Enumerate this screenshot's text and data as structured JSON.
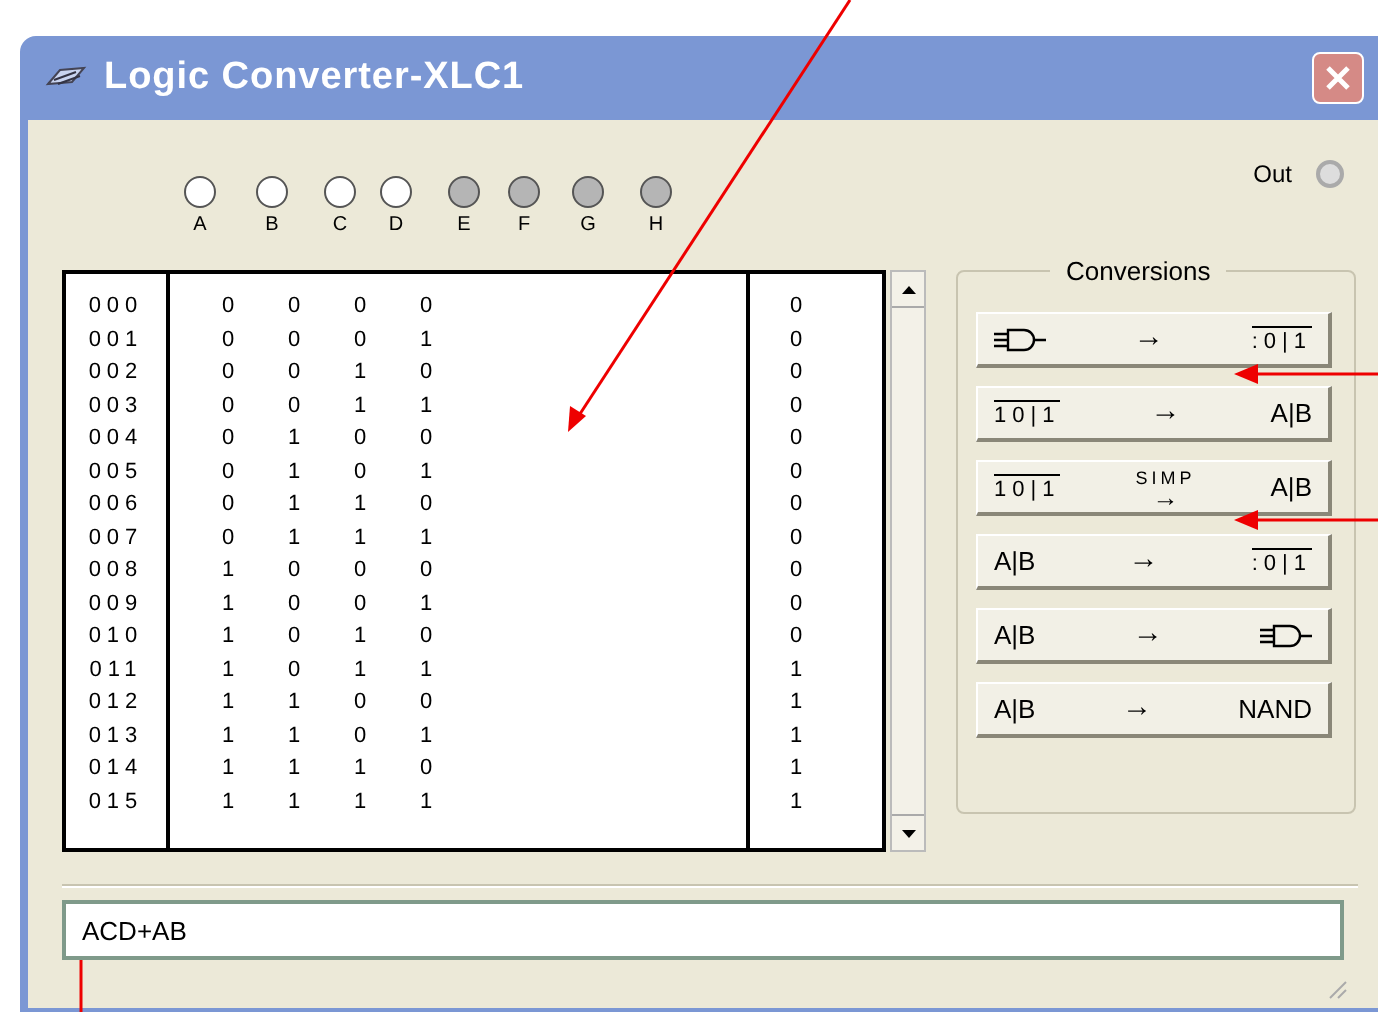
{
  "window": {
    "title": "Logic Converter-XLC1"
  },
  "output_terminal": {
    "label": "Out"
  },
  "input_terminals": [
    {
      "label": "A",
      "active": true
    },
    {
      "label": "B",
      "active": true
    },
    {
      "label": "C",
      "active": true
    },
    {
      "label": "D",
      "active": true
    },
    {
      "label": "E",
      "active": false
    },
    {
      "label": "F",
      "active": false
    },
    {
      "label": "G",
      "active": false
    },
    {
      "label": "H",
      "active": false
    }
  ],
  "truth_table": {
    "rows": [
      {
        "index": "000",
        "inputs": [
          "0",
          "0",
          "0",
          "0"
        ],
        "output": "0"
      },
      {
        "index": "001",
        "inputs": [
          "0",
          "0",
          "0",
          "1"
        ],
        "output": "0"
      },
      {
        "index": "002",
        "inputs": [
          "0",
          "0",
          "1",
          "0"
        ],
        "output": "0"
      },
      {
        "index": "003",
        "inputs": [
          "0",
          "0",
          "1",
          "1"
        ],
        "output": "0"
      },
      {
        "index": "004",
        "inputs": [
          "0",
          "1",
          "0",
          "0"
        ],
        "output": "0"
      },
      {
        "index": "005",
        "inputs": [
          "0",
          "1",
          "0",
          "1"
        ],
        "output": "0"
      },
      {
        "index": "006",
        "inputs": [
          "0",
          "1",
          "1",
          "0"
        ],
        "output": "0"
      },
      {
        "index": "007",
        "inputs": [
          "0",
          "1",
          "1",
          "1"
        ],
        "output": "0"
      },
      {
        "index": "008",
        "inputs": [
          "1",
          "0",
          "0",
          "0"
        ],
        "output": "0"
      },
      {
        "index": "009",
        "inputs": [
          "1",
          "0",
          "0",
          "1"
        ],
        "output": "0"
      },
      {
        "index": "010",
        "inputs": [
          "1",
          "0",
          "1",
          "0"
        ],
        "output": "0"
      },
      {
        "index": "011",
        "inputs": [
          "1",
          "0",
          "1",
          "1"
        ],
        "output": "1"
      },
      {
        "index": "012",
        "inputs": [
          "1",
          "1",
          "0",
          "0"
        ],
        "output": "1"
      },
      {
        "index": "013",
        "inputs": [
          "1",
          "1",
          "0",
          "1"
        ],
        "output": "1"
      },
      {
        "index": "014",
        "inputs": [
          "1",
          "1",
          "1",
          "0"
        ],
        "output": "1"
      },
      {
        "index": "015",
        "inputs": [
          "1",
          "1",
          "1",
          "1"
        ],
        "output": "1"
      }
    ]
  },
  "conversions": {
    "title": "Conversions",
    "buttons": [
      {
        "parts": [
          {
            "kind": "gate"
          },
          {
            "kind": "arrow",
            "text": "→"
          },
          {
            "kind": "table",
            "text": ":0|1"
          }
        ]
      },
      {
        "parts": [
          {
            "kind": "table",
            "text": "10|1"
          },
          {
            "kind": "arrow",
            "text": "→"
          },
          {
            "kind": "text",
            "text": "A|B"
          }
        ]
      },
      {
        "parts": [
          {
            "kind": "table",
            "text": "10|1"
          },
          {
            "kind": "simp",
            "text": "SIMP",
            "arrow": "→"
          },
          {
            "kind": "text",
            "text": "A|B"
          }
        ]
      },
      {
        "parts": [
          {
            "kind": "text",
            "text": "A|B"
          },
          {
            "kind": "arrow",
            "text": "→"
          },
          {
            "kind": "table",
            "text": ":0|1"
          }
        ]
      },
      {
        "parts": [
          {
            "kind": "text",
            "text": "A|B"
          },
          {
            "kind": "arrow",
            "text": "→"
          },
          {
            "kind": "gate"
          }
        ]
      },
      {
        "parts": [
          {
            "kind": "text",
            "text": "A|B"
          },
          {
            "kind": "arrow",
            "text": "→"
          },
          {
            "kind": "text",
            "text": "NAND"
          }
        ]
      }
    ]
  },
  "expression": {
    "value": "ACD+AB"
  }
}
